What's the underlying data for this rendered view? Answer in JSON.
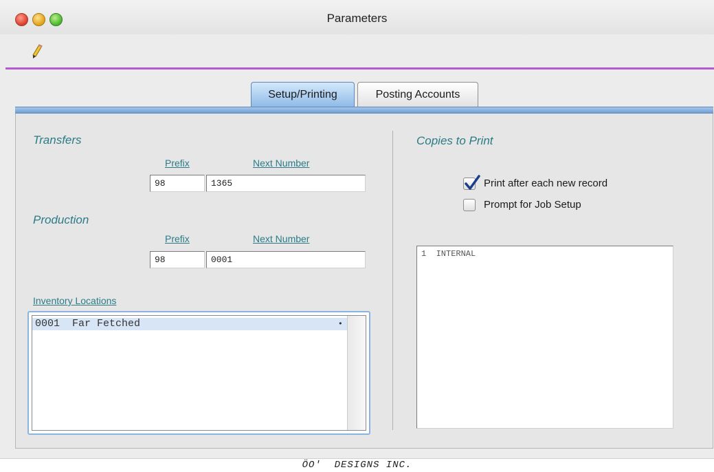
{
  "window": {
    "title": "Parameters"
  },
  "toolbar": {
    "edit_icon": "pencil-icon"
  },
  "tabs": [
    {
      "label": "Setup/Printing",
      "active": true
    },
    {
      "label": "Posting Accounts",
      "active": false
    }
  ],
  "transfers": {
    "title": "Transfers",
    "prefix_label": "Prefix",
    "next_number_label": "Next Number",
    "prefix_value": "98",
    "next_number_value": "1365"
  },
  "production": {
    "title": "Production",
    "prefix_label": "Prefix",
    "next_number_label": "Next Number",
    "prefix_value": "98",
    "next_number_value": "0001"
  },
  "inventory_locations": {
    "label": "Inventory Locations",
    "items": [
      {
        "code": "0001",
        "name": "Far Fetched",
        "text": "0001  Far Fetched"
      }
    ]
  },
  "copies_to_print": {
    "title": "Copies to Print",
    "print_after_each": {
      "label": "Print after each new record",
      "checked": true
    },
    "prompt_job_setup": {
      "label": "Prompt for Job Setup",
      "checked": false
    },
    "items": [
      {
        "text": "1  INTERNAL"
      }
    ]
  },
  "status": {
    "text": "ÖO′  DESIGNS INC."
  },
  "colors": {
    "accent": "#b45acf",
    "label_teal": "#2b7b86",
    "tab_active": "#8fbbe8"
  }
}
